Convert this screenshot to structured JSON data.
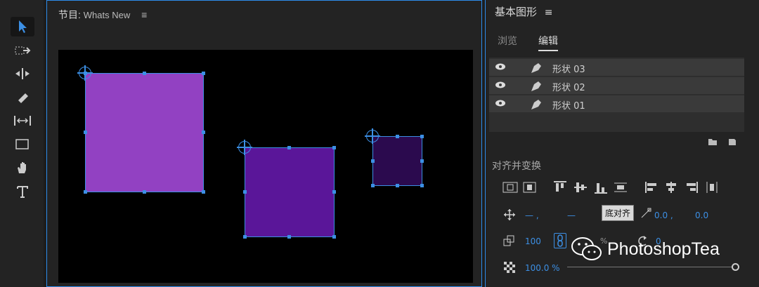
{
  "program": {
    "label": "节目:",
    "sequence": "Whats New",
    "menu": "≡"
  },
  "egp": {
    "title": "基本图形",
    "menu": "≡",
    "tabs": [
      "浏览",
      "编辑"
    ]
  },
  "layers": [
    {
      "name": "形状 03"
    },
    {
      "name": "形状 02"
    },
    {
      "name": "形状 01"
    }
  ],
  "align_section": "对齐并变换",
  "position": {
    "x": "0.0 ,",
    "y": "0.0"
  },
  "scale": "100",
  "rotation_value": "0",
  "opacity": "100.0 %",
  "tooltip": "底对齐",
  "dashes": {
    "x": "— ,",
    "y": "—"
  },
  "percent": "%",
  "watermark": "PhotoshopTea",
  "colors": {
    "accent": "#3c8fe4",
    "shape1": "#9241c2",
    "shape2": "#5a1699",
    "shape3": "#2b0a4e"
  }
}
